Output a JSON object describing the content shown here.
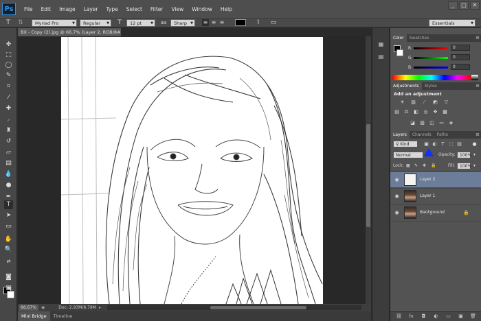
{
  "app": {
    "logo": "Ps",
    "menu": [
      "File",
      "Edit",
      "Image",
      "Layer",
      "Type",
      "Select",
      "Filter",
      "View",
      "Window",
      "Help"
    ],
    "window_controls": [
      "_",
      "□",
      "✕"
    ]
  },
  "options_bar": {
    "font_family": "Myriad Pro",
    "font_style": "Regular",
    "font_size": "12 pt",
    "anti_alias": "Sharp",
    "text_color": "#000000",
    "workspace": "Essentials"
  },
  "document": {
    "tab_title": "BX - Copy (2).jpg @ 66.7% (Layer 2, RGB/8#) *",
    "zoom": "66.67%",
    "doc_info": "Doc: 2.93M/8.79M"
  },
  "bottom_tabs": [
    "Mini Bridge",
    "Timeline"
  ],
  "color_panel": {
    "tabs": [
      "Color",
      "Swatches"
    ],
    "foreground": "#000000",
    "background": "#ffffff",
    "sliders": [
      {
        "label": "R",
        "value": "0",
        "color": "#ff0000"
      },
      {
        "label": "G",
        "value": "0",
        "color": "#00ff00"
      },
      {
        "label": "B",
        "value": "0",
        "color": "#0000ff"
      }
    ]
  },
  "adjustments_panel": {
    "tabs": [
      "Adjustments",
      "Styles"
    ],
    "title": "Add an adjustment",
    "icons": [
      "brightness-contrast-icon",
      "levels-icon",
      "curves-icon",
      "exposure-icon",
      "vibrance-icon",
      "hue-saturation-icon",
      "color-balance-icon",
      "black-white-icon",
      "photo-filter-icon",
      "channel-mixer-icon",
      "color-lookup-icon",
      "invert-icon",
      "posterize-icon",
      "threshold-icon",
      "gradient-map-icon",
      "selective-color-icon"
    ]
  },
  "layers_panel": {
    "tabs": [
      "Layers",
      "Channels",
      "Paths"
    ],
    "filter_kind": "Kind",
    "blend_mode": "Normal",
    "opacity_label": "Opacity:",
    "opacity": "100%",
    "lock_label": "Lock:",
    "fill_label": "Fill:",
    "fill": "100%",
    "layers": [
      {
        "name": "Layer 2",
        "selected": true,
        "thumb": "sketch"
      },
      {
        "name": "Layer 1",
        "selected": false,
        "thumb": "photo"
      },
      {
        "name": "Background",
        "selected": false,
        "thumb": "photo",
        "locked": true
      }
    ]
  },
  "annotation_arrow_color": "#1030ff"
}
